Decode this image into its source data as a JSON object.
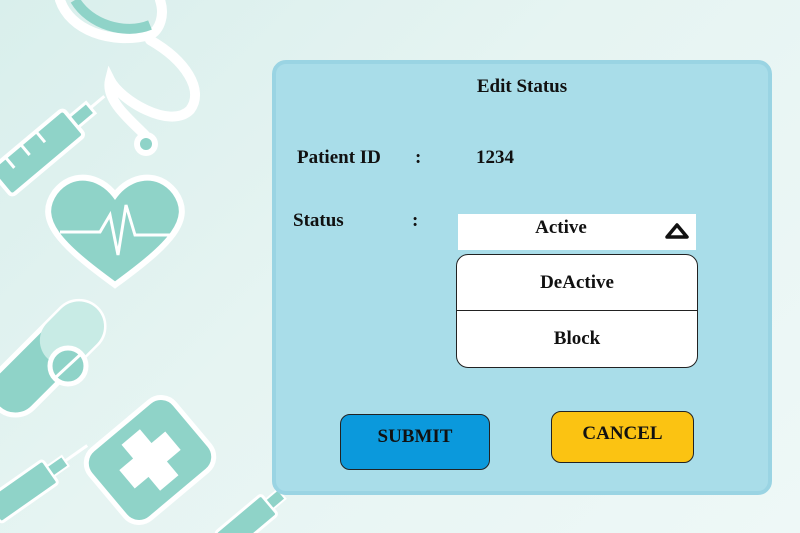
{
  "dialog": {
    "title": "Edit Status",
    "patient_id_label": "Patient ID",
    "patient_id_separator": ":",
    "patient_id_value": "1234",
    "status_label": "Status",
    "status_separator": ":",
    "status_selected": "Active",
    "status_options": [
      "DeActive",
      "Block"
    ],
    "submit_label": "SUBMIT",
    "cancel_label": "CANCEL"
  },
  "colors": {
    "panel": "#a9dde9",
    "submit": "#0b99dc",
    "cancel": "#fbc312",
    "art": "#8fd3c8"
  },
  "icons": {
    "caret": "triangle-up-icon",
    "background": [
      "stethoscope-icon",
      "syringe-icon",
      "heart-pulse-icon",
      "pill-icon",
      "medicine-bottle-icon"
    ]
  }
}
